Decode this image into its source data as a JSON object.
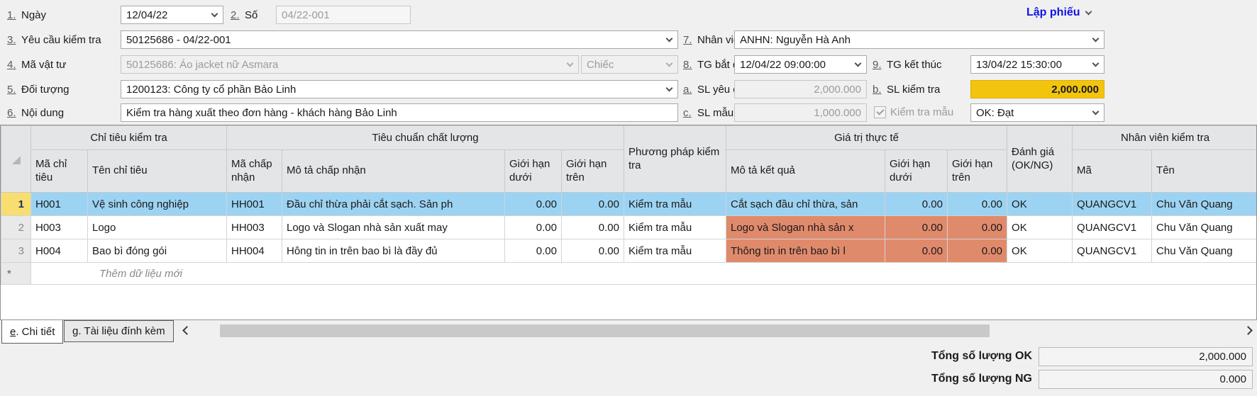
{
  "colors": {
    "selection_blue": "#9cd3f2",
    "selection_row_header": "#f8de71",
    "warning_cell": "#e08a6c",
    "highlight_field": "#f2c40e",
    "link_blue": "#1212e8",
    "header_bg": "#e4e5e7"
  },
  "toolbar": {
    "lap_phieu_label": "Lập phiếu"
  },
  "form": {
    "ngay": {
      "num": "1.",
      "label": "Ngày",
      "value": "12/04/22"
    },
    "so": {
      "num": "2.",
      "label": "Số",
      "value": "04/22-001"
    },
    "yeu_cau": {
      "num": "3.",
      "label": "Yêu cầu kiểm tra",
      "value": "50125686 - 04/22-001"
    },
    "ma_vat_tu": {
      "num": "4.",
      "label": "Mã vật tư",
      "value": "50125686: Áo jacket nữ Asmara",
      "unit": "Chiếc"
    },
    "doi_tuong": {
      "num": "5.",
      "label": "Đối tượng",
      "value": "1200123: Công ty cổ phần Bảo Linh"
    },
    "noi_dung": {
      "num": "6.",
      "label": "Nội dung",
      "value": "Kiểm tra hàng xuất theo đơn hàng - khách hàng Bảo Linh"
    },
    "nhan_vien": {
      "num": "7.",
      "label": "Nhân viên",
      "value": "ANHN: Nguyễn Hà Anh"
    },
    "tg_bat_dau": {
      "num": "8.",
      "label": "TG bắt đầu",
      "value": "12/04/22 09:00:00"
    },
    "tg_ket_thuc": {
      "num": "9.",
      "label": "TG kết thúc",
      "value": "13/04/22 15:30:00"
    },
    "sl_yeu_cau": {
      "num": "a.",
      "label": "SL yêu cầu",
      "value": "2,000.000"
    },
    "sl_kiem_tra": {
      "num": "b.",
      "label": "SL kiểm tra",
      "value": "2,000.000"
    },
    "sl_mau_yeu_cau": {
      "num": "c.",
      "label": "SL mẫu yêu cầu",
      "value": "1,000.000"
    },
    "kiem_tra_mau": {
      "label": "Kiểm tra mẫu",
      "checked": true
    },
    "ket_qua_mau": {
      "value": "OK: Đạt"
    }
  },
  "grid": {
    "groups": [
      "Chỉ tiêu kiểm tra",
      "Tiêu chuẩn chất lượng",
      "Phương pháp kiểm tra",
      "Giá trị thực tế",
      "Đánh giá (OK/NG)",
      "Nhân viên kiểm tra"
    ],
    "columns": [
      "Mã chỉ tiêu",
      "Tên chỉ tiêu",
      "Mã chấp nhận",
      "Mô tả chấp nhận",
      "Giới hạn dưới",
      "Giới hạn trên",
      "Mô tả kết quả",
      "Giới hạn dưới",
      "Giới hạn trên",
      "Mã",
      "Tên"
    ],
    "rows": [
      {
        "num": "1",
        "selected": true,
        "cells": [
          "H001",
          "Vệ sinh công nghiệp",
          "HH001",
          "Đầu chỉ thừa phải cắt sạch. Sản ph",
          "0.00",
          "0.00",
          "Kiểm tra mẫu",
          "Cắt sạch đầu chỉ thừa, sản",
          "0.00",
          "0.00",
          "OK",
          "QUANGCV1",
          "Chu Văn Quang"
        ]
      },
      {
        "num": "2",
        "selected": false,
        "cells": [
          "H003",
          "Logo",
          "HH003",
          "Logo và Slogan nhà sản xuất may",
          "0.00",
          "0.00",
          "Kiểm tra mẫu",
          "Logo và Slogan nhà sản x",
          "0.00",
          "0.00",
          "OK",
          "QUANGCV1",
          "Chu Văn Quang"
        ]
      },
      {
        "num": "3",
        "selected": false,
        "cells": [
          "H004",
          "Bao bì đóng gói",
          "HH004",
          "Hông tin in trên bao bì là đầy đủ",
          "0.00",
          "0.00",
          "Kiểm tra mẫu",
          "Thông tin in trên bao bì l",
          "0.00",
          "0.00",
          "OK",
          "QUANGCV1",
          "Chu Văn Quang"
        ]
      }
    ],
    "new_row": {
      "num": "*",
      "label": "Thêm dữ liệu mới"
    }
  },
  "tabs": [
    {
      "hotkey": "e",
      "rest": ". Chi tiết",
      "active": true
    },
    {
      "hotkey": "g",
      "rest": ". Tài liệu đính kèm",
      "active": false
    }
  ],
  "totals": {
    "ok_label": "Tổng số lượng OK",
    "ok_value": "2,000.000",
    "ng_label": "Tổng số lượng NG",
    "ng_value": "0.000"
  }
}
